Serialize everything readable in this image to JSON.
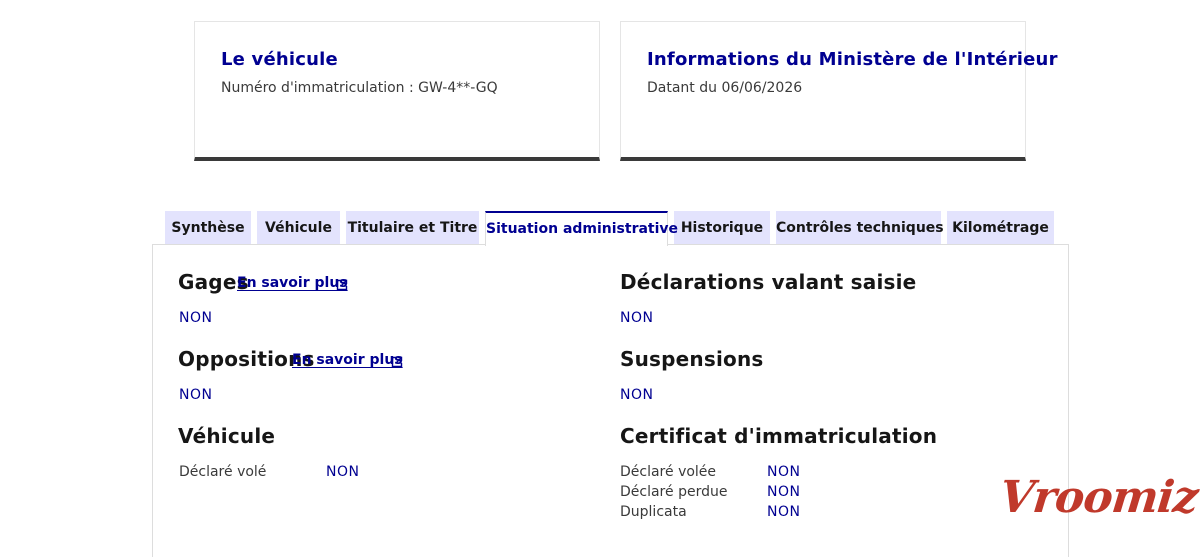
{
  "vehicle_card": {
    "title": "Le véhicule",
    "subtitle": "Numéro d'immatriculation : GW-4**-GQ"
  },
  "ministry_card": {
    "title": "Informations du Ministère de l'Intérieur",
    "subtitle": "Datant du 06/06/2026"
  },
  "tabs": [
    {
      "label": "Synthèse"
    },
    {
      "label": "Véhicule"
    },
    {
      "label": "Titulaire et Titre"
    },
    {
      "label": "Situation administrative"
    },
    {
      "label": "Historique"
    },
    {
      "label": "Contrôles techniques"
    },
    {
      "label": "Kilométrage"
    }
  ],
  "active_tab": "Situation administrative",
  "sections": {
    "gages": {
      "title": "Gages",
      "link": "En savoir plus",
      "value": "NON"
    },
    "oppositions": {
      "title": "Oppositions",
      "link": "En savoir plus",
      "value": "NON"
    },
    "vehicule": {
      "title": "Véhicule",
      "rows": [
        {
          "label": "Déclaré volé",
          "value": "NON"
        }
      ]
    },
    "declarations": {
      "title": "Déclarations valant saisie",
      "value": "NON"
    },
    "suspensions": {
      "title": "Suspensions",
      "value": "NON"
    },
    "certificat": {
      "title": "Certificat d'immatriculation",
      "rows": [
        {
          "label": "Déclaré volée",
          "value": "NON"
        },
        {
          "label": "Déclaré perdue",
          "value": "NON"
        },
        {
          "label": "Duplicata",
          "value": "NON"
        }
      ]
    }
  },
  "logo_text": "Vroomiz",
  "colors": {
    "primary": "#000091",
    "tab_bg": "#e3e3fd",
    "logo": "#c0392b"
  }
}
